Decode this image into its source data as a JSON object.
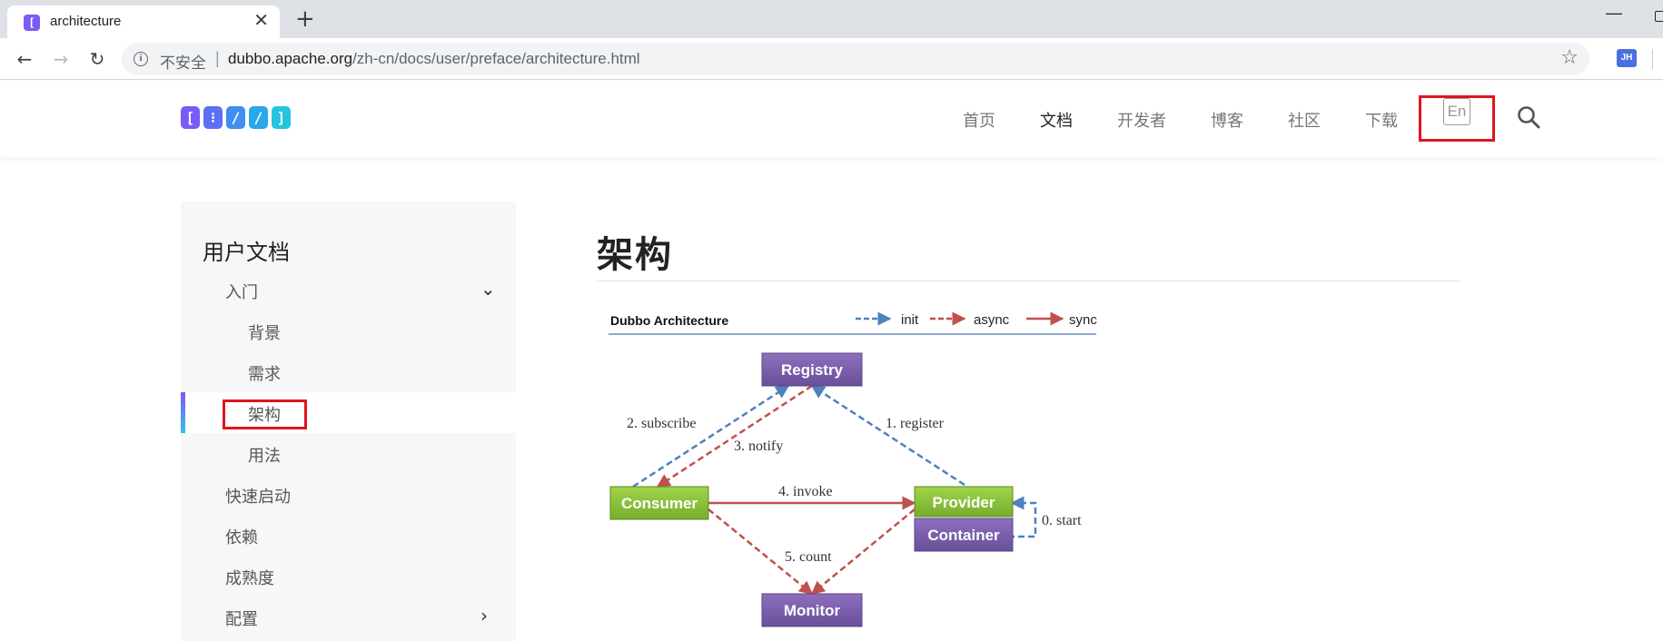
{
  "browser": {
    "tab_title": "architecture",
    "tab_icon": "dubbo-favicon-icon",
    "insecure_label": "不安全",
    "url_host": "dubbo.apache.org",
    "url_path": "/zh-cn/docs/user/preface/architecture.html",
    "extension_label": "JH"
  },
  "header": {
    "logo_letters": [
      "[",
      "⁝",
      "/",
      "/",
      "]"
    ],
    "logo_colors": [
      "#7a5af8",
      "#5d6ff3",
      "#3f8ef0",
      "#2aa7ea",
      "#22c4e0"
    ],
    "nav": [
      {
        "label": "首页",
        "active": false
      },
      {
        "label": "文档",
        "active": true
      },
      {
        "label": "开发者",
        "active": false
      },
      {
        "label": "博客",
        "active": false
      },
      {
        "label": "社区",
        "active": false
      },
      {
        "label": "下载",
        "active": false
      }
    ],
    "lang_button": "En",
    "highlight_color": "#e0141e"
  },
  "sidebar": {
    "title": "用户文档",
    "items": [
      {
        "label": "入门",
        "level": 1,
        "chevron": "down"
      },
      {
        "label": "背景",
        "level": 2
      },
      {
        "label": "需求",
        "level": 2
      },
      {
        "label": "架构",
        "level": 2,
        "active": true
      },
      {
        "label": "用法",
        "level": 2
      },
      {
        "label": "快速启动",
        "level": 1
      },
      {
        "label": "依赖",
        "level": 1
      },
      {
        "label": "成熟度",
        "level": 1
      },
      {
        "label": "配置",
        "level": 1,
        "chevron": "right"
      }
    ]
  },
  "content": {
    "title": "架构",
    "diagram": {
      "heading": "Dubbo Architecture",
      "legend": {
        "init": "init",
        "async": "async",
        "sync": "sync"
      },
      "nodes": {
        "registry": "Registry",
        "consumer": "Consumer",
        "provider": "Provider",
        "container": "Container",
        "monitor": "Monitor"
      },
      "edges": {
        "start": "0. start",
        "register": "1. register",
        "subscribe": "2. subscribe",
        "notify": "3. notify",
        "invoke": "4. invoke",
        "count": "5. count"
      },
      "colors": {
        "init": "#4f81bd",
        "async": "#c0504d",
        "sync": "#c0504d",
        "purple_node": "#7b5ea7",
        "green_node": "#8cc63f"
      }
    }
  }
}
